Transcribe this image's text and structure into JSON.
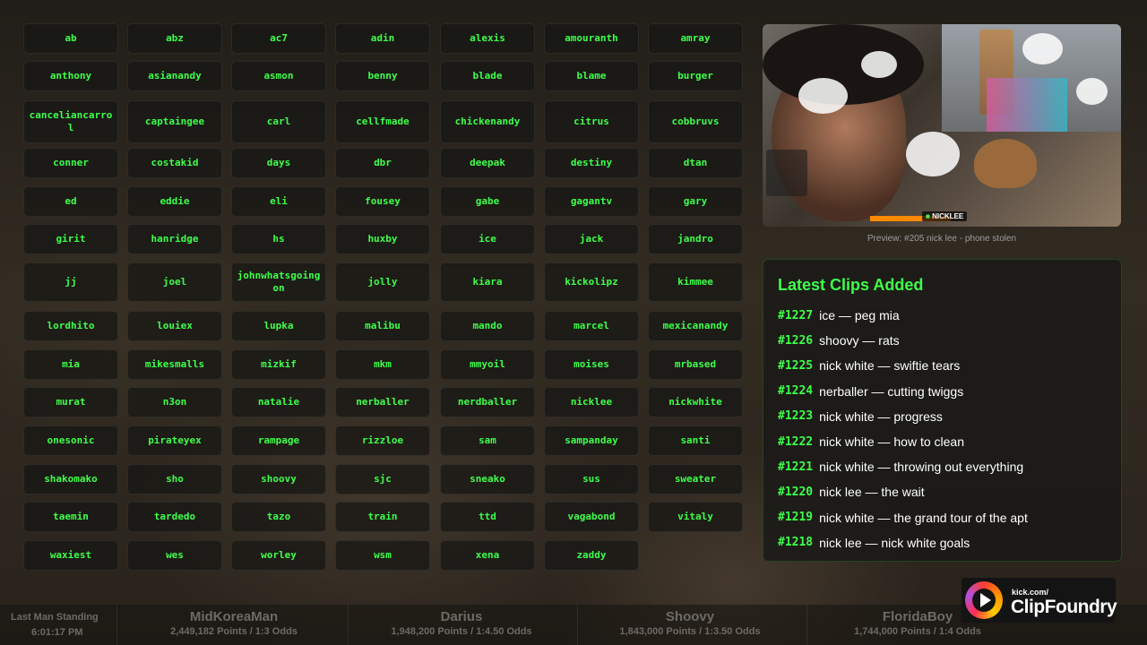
{
  "names": [
    "ab",
    "abz",
    "ac7",
    "adin",
    "alexis",
    "amouranth",
    "amray",
    "anthony",
    "asianandy",
    "asmon",
    "benny",
    "blade",
    "blame",
    "burger",
    "canceliancarrol",
    "captaingee",
    "carl",
    "cellfmade",
    "chickenandy",
    "citrus",
    "cobbruvs",
    "conner",
    "costakid",
    "days",
    "dbr",
    "deepak",
    "destiny",
    "dtan",
    "ed",
    "eddie",
    "eli",
    "fousey",
    "gabe",
    "gagantv",
    "gary",
    "girit",
    "hanridge",
    "hs",
    "huxby",
    "ice",
    "jack",
    "jandro",
    "jj",
    "joel",
    "johnwhatsgoingon",
    "jolly",
    "kiara",
    "kickolipz",
    "kimmee",
    "lordhito",
    "louiex",
    "lupka",
    "malibu",
    "mando",
    "marcel",
    "mexicanandy",
    "mia",
    "mikesmalls",
    "mizkif",
    "mkm",
    "mmyoil",
    "moises",
    "mrbased",
    "murat",
    "n3on",
    "natalie",
    "nerballer",
    "nerdballer",
    "nicklee",
    "nickwhite",
    "onesonic",
    "pirateyex",
    "rampage",
    "rizzloe",
    "sam",
    "sampanday",
    "santi",
    "shakomako",
    "sho",
    "shoovy",
    "sjc",
    "sneako",
    "sus",
    "sweater",
    "taemin",
    "tardedo",
    "tazo",
    "train",
    "ttd",
    "vagabond",
    "vitaly",
    "waxiest",
    "wes",
    "worley",
    "wsm",
    "xena",
    "zaddy"
  ],
  "preview": {
    "caption": "Preview: #205 nick lee - phone stolen",
    "overlay_tag": "NICKLEE"
  },
  "latest_clips": {
    "title": "Latest Clips Added",
    "items": [
      {
        "num": "#1227",
        "text": "ice — peg mia"
      },
      {
        "num": "#1226",
        "text": "shoovy — rats"
      },
      {
        "num": "#1225",
        "text": "nick white — swiftie tears"
      },
      {
        "num": "#1224",
        "text": "nerballer — cutting twiggs"
      },
      {
        "num": "#1223",
        "text": "nick white — progress"
      },
      {
        "num": "#1222",
        "text": "nick white — how to clean"
      },
      {
        "num": "#1221",
        "text": "nick white — throwing out everything"
      },
      {
        "num": "#1220",
        "text": "nick lee — the wait"
      },
      {
        "num": "#1219",
        "text": "nick white — the grand tour of the apt"
      },
      {
        "num": "#1218",
        "text": "nick lee — nick white goals"
      }
    ]
  },
  "ticker": {
    "label": "Last Man Standing",
    "time": "6:01:17 PM",
    "entries": [
      {
        "name": "MidKoreaMan",
        "points": "2,449,182 Points / 1:3 Odds"
      },
      {
        "name": "Darius",
        "points": "1,948,200 Points / 1:4.50 Odds"
      },
      {
        "name": "Shoovy",
        "points": "1,843,000 Points / 1:3.50 Odds"
      },
      {
        "name": "FloridaBoy",
        "points": "1,744,000 Points / 1:4 Odds"
      }
    ]
  },
  "logo": {
    "small": "kick.com/",
    "big": "ClipFoundry"
  },
  "colors": {
    "accent": "#3dff4a",
    "panel": "#181816"
  }
}
